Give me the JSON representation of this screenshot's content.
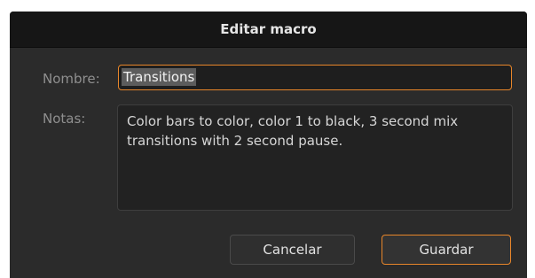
{
  "dialog": {
    "title": "Editar macro"
  },
  "form": {
    "name_label": "Nombre:",
    "name_value": "Transitions",
    "notes_label": "Notas:",
    "notes_value": "Color bars to color, color 1 to black, 3 second mix transitions with 2 second pause."
  },
  "buttons": {
    "cancel_label": "Cancelar",
    "save_label": "Guardar"
  },
  "colors": {
    "accent": "#e8862a",
    "dialog_bg": "#2b2b2b",
    "titlebar_bg": "#161616"
  }
}
